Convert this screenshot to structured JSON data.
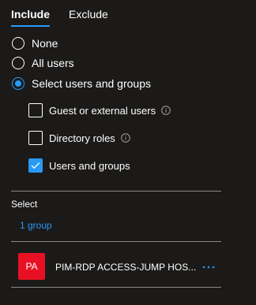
{
  "tabs": [
    {
      "label": "Include",
      "active": true
    },
    {
      "label": "Exclude",
      "active": false
    }
  ],
  "radio_options": [
    {
      "label": "None",
      "checked": false
    },
    {
      "label": "All users",
      "checked": false
    },
    {
      "label": "Select users and groups",
      "checked": true
    }
  ],
  "checkbox_options": [
    {
      "label": "Guest or external users",
      "checked": false,
      "info_icon": "info-icon"
    },
    {
      "label": "Directory roles",
      "checked": false,
      "info_icon": "info-icon"
    },
    {
      "label": "Users and groups",
      "checked": true
    }
  ],
  "select": {
    "label": "Select",
    "link_text": "1 group"
  },
  "selected_items": [
    {
      "initials": "PA",
      "name": "PIM-RDP ACCESS-JUMP HOS...",
      "avatar_color": "#e81123",
      "menu_icon": "more-icon"
    }
  ],
  "colors": {
    "accent": "#2899f5",
    "background": "#1b1a19",
    "avatar": "#e81123"
  }
}
